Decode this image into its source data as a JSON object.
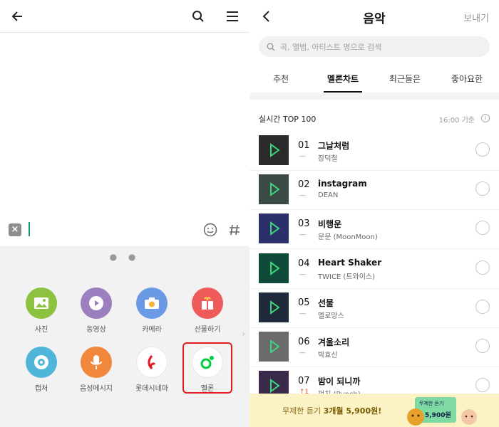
{
  "left": {
    "apps_row1": [
      {
        "label": "사진",
        "icon": "photo-icon",
        "color": "#8dc241"
      },
      {
        "label": "동영상",
        "icon": "video-icon",
        "color": "#9b7fbf"
      },
      {
        "label": "카메라",
        "icon": "camera-icon",
        "color": "#6a9ae6"
      },
      {
        "label": "선물하기",
        "icon": "gift-icon",
        "color": "#ef5a5a"
      }
    ],
    "apps_row2": [
      {
        "label": "캡처",
        "icon": "capture-icon",
        "color": "#4fb6d9"
      },
      {
        "label": "음성메시지",
        "icon": "mic-icon",
        "color": "#f0873a"
      },
      {
        "label": "롯데시네마",
        "icon": "lotte-cinema-icon",
        "color": "#ffffff"
      },
      {
        "label": "멜론",
        "icon": "melon-icon",
        "color": "#ffffff"
      }
    ],
    "page_dots": "● ●"
  },
  "right": {
    "title": "음악",
    "send_label": "보내기",
    "search_placeholder": "곡, 앨범, 아티스트 명으로 검색",
    "tabs": [
      "추천",
      "멜론차트",
      "최근들은",
      "좋아요한"
    ],
    "chart_title": "실시간 TOP 100",
    "chart_time": "16:00 기준",
    "songs": [
      {
        "rank": "01",
        "movement": "—",
        "title": "그날처럼",
        "artist": "장덕철",
        "art": "#2b2b2b"
      },
      {
        "rank": "02",
        "movement": "—",
        "title": "instagram",
        "artist": "DEAN",
        "art": "#3a4a45"
      },
      {
        "rank": "03",
        "movement": "—",
        "title": "비행운",
        "artist": "문문 (MoonMoon)",
        "art": "#2b2f6a"
      },
      {
        "rank": "04",
        "movement": "—",
        "title": "Heart Shaker",
        "artist": "TWICE (트와이스)",
        "art": "#0f4a3a"
      },
      {
        "rank": "05",
        "movement": "—",
        "title": "선물",
        "artist": "멜로망스",
        "art": "#1f2b3a"
      },
      {
        "rank": "06",
        "movement": "—",
        "title": "겨울소리",
        "artist": "박효신",
        "art": "#6b6b6b"
      },
      {
        "rank": "07",
        "movement": "↑1",
        "title": "밤이 되니까",
        "artist": "펀치 (Punch)",
        "art": "#3a2a4a"
      }
    ],
    "banner_text_pre": "무제한 듣기 ",
    "banner_text_bold": "3개월 5,900원!",
    "promo_line1": "무제한 듣기",
    "promo_line2": "5,900원"
  }
}
